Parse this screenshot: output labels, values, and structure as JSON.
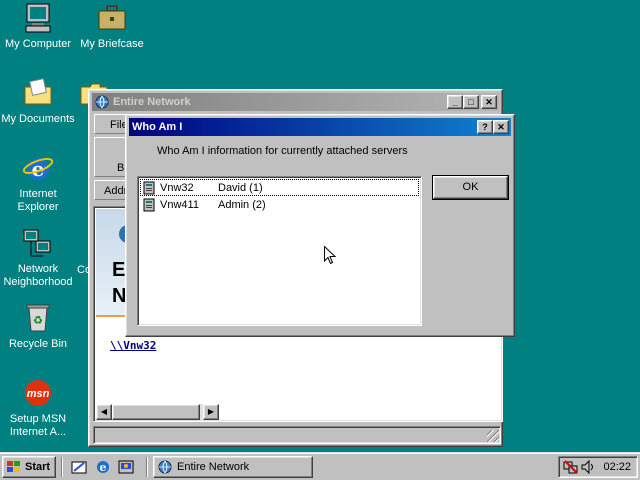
{
  "desktop": {
    "icons": [
      {
        "label": "My Computer"
      },
      {
        "label": "My Briefcase"
      },
      {
        "label": "My Documents"
      },
      {
        "label": "Internet Explorer"
      },
      {
        "label": "Network Neighborhood"
      },
      {
        "label": "Recycle Bin"
      },
      {
        "label": "Setup MSN Internet A..."
      }
    ],
    "partial_icon_label": "Co"
  },
  "explorer": {
    "title": "Entire Network",
    "menu_fragment": "File",
    "toolbar_fragment": "B",
    "address_fragment": "Addr",
    "banner_letter_1": "E",
    "banner_letter_2": "N",
    "link": "\\\\Vnw32"
  },
  "dialog": {
    "title": "Who Am I",
    "heading": "Who Am I information for currently attached servers",
    "help_btn": "?",
    "close_btn": "✕",
    "ok_label": "OK",
    "rows": [
      {
        "server": "Vnw32",
        "user": "David (1)"
      },
      {
        "server": "Vnw411",
        "user": "Admin (2)"
      }
    ]
  },
  "taskbar": {
    "start_label": "Start",
    "task_label": "Entire Network",
    "clock": "02:22"
  },
  "colors": {
    "desktop": "#008080",
    "active_title": "#000080",
    "face": "#c0c0c0"
  }
}
